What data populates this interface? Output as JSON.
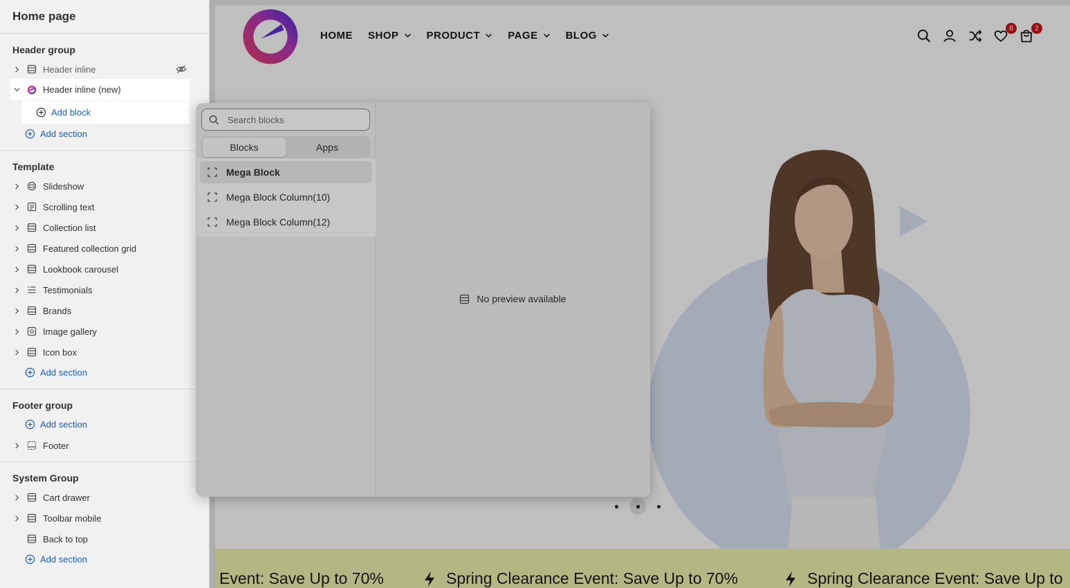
{
  "sidebar": {
    "page_title": "Home page",
    "header_group": {
      "title": "Header group",
      "items": [
        {
          "label": "Header inline",
          "icon": "section-icon",
          "hidden": true
        },
        {
          "label": "Header inline (new)",
          "icon": "app-logo-icon",
          "expanded": true
        }
      ],
      "add_block": "Add block",
      "add_section": "Add section"
    },
    "template": {
      "title": "Template",
      "items": [
        {
          "label": "Slideshow",
          "icon": "slideshow-icon"
        },
        {
          "label": "Scrolling text",
          "icon": "text-icon"
        },
        {
          "label": "Collection list",
          "icon": "section-icon"
        },
        {
          "label": "Featured collection grid",
          "icon": "section-icon"
        },
        {
          "label": "Lookbook carousel",
          "icon": "section-icon"
        },
        {
          "label": "Testimonials",
          "icon": "list-icon"
        },
        {
          "label": "Brands",
          "icon": "section-icon"
        },
        {
          "label": "Image gallery",
          "icon": "gallery-icon"
        },
        {
          "label": "Icon box",
          "icon": "section-icon"
        }
      ],
      "add_section": "Add section"
    },
    "footer_group": {
      "title": "Footer group",
      "add_section": "Add section",
      "items": [
        {
          "label": "Footer",
          "icon": "footer-icon"
        }
      ]
    },
    "system_group": {
      "title": "System Group",
      "items": [
        {
          "label": "Cart drawer",
          "icon": "section-icon"
        },
        {
          "label": "Toolbar mobile",
          "icon": "section-icon"
        },
        {
          "label": "Back to top",
          "icon": "section-icon"
        }
      ],
      "add_section": "Add section"
    }
  },
  "picker": {
    "search_placeholder": "Search blocks",
    "tabs": [
      "Blocks",
      "Apps"
    ],
    "active_tab": "Blocks",
    "blocks": [
      "Mega Block",
      "Mega Block Column(10)",
      "Mega Block Column(12)"
    ],
    "selected_block": "Mega Block",
    "no_preview": "No preview available"
  },
  "store": {
    "nav": [
      {
        "label": "HOME",
        "dropdown": false
      },
      {
        "label": "SHOP",
        "dropdown": true
      },
      {
        "label": "PRODUCT",
        "dropdown": true
      },
      {
        "label": "PAGE",
        "dropdown": true
      },
      {
        "label": "BLOG",
        "dropdown": true
      }
    ],
    "wishlist_count": "8",
    "cart_count": "2",
    "slide_count": 3,
    "active_slide": 2,
    "marquee": [
      "Event: Save Up to 70%",
      "Spring Clearance Event: Save Up to 70%",
      "Spring Clearance Event: Save Up to"
    ],
    "colors": {
      "accent": "#c8161d",
      "marquee_bg": "#f0f5b0",
      "hero_circle": "#dbe5f3"
    }
  }
}
